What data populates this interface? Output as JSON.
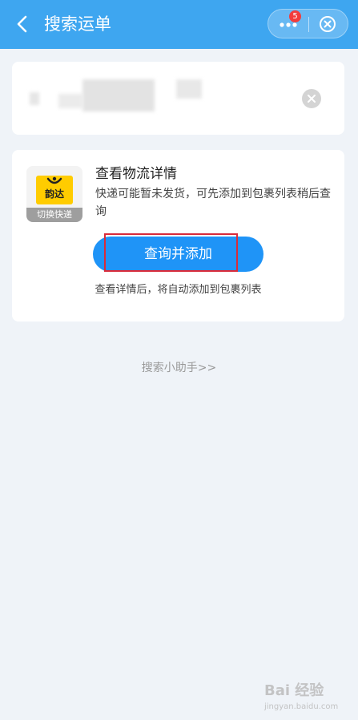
{
  "header": {
    "title": "搜索运单",
    "badge_count": "5",
    "color": "#3ea6f0"
  },
  "search": {
    "query": ""
  },
  "result": {
    "carrier_logo": "韵达",
    "switch_label": "切换快递",
    "title": "查看物流详情",
    "description": "快递可能暂未发货，可先添加到包裹列表稍后查询",
    "button_label": "查询并添加",
    "hint": "查看详情后，将自动添加到包裹列表"
  },
  "helper": {
    "label": "搜索小助手>>"
  },
  "watermark": {
    "text": "Bai 经验",
    "sub": "jingyan.baidu.com"
  },
  "icons": {
    "back": "chevron-left-icon",
    "more": "more-dots-icon",
    "close": "close-circle-icon",
    "clear": "clear-x-icon"
  },
  "colors": {
    "accent": "#1f94f7",
    "highlight": "#d92b3a"
  }
}
